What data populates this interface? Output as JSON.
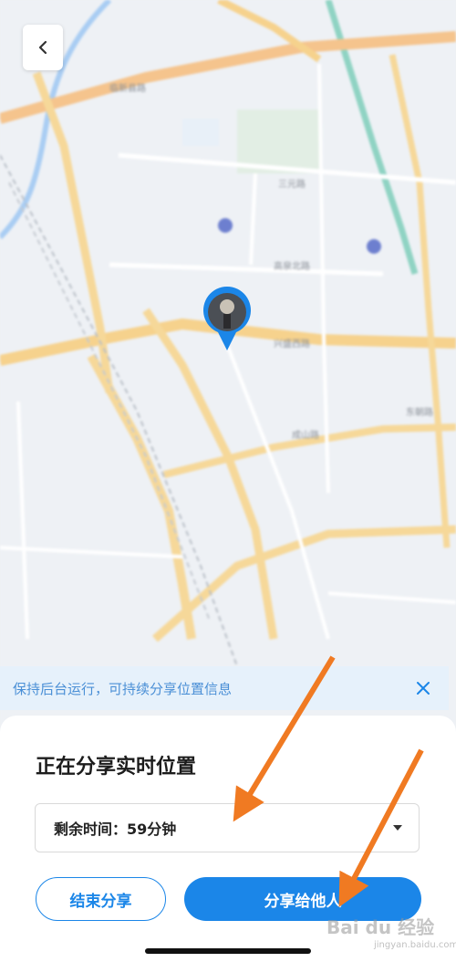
{
  "map": {
    "road_labels": [
      "临新县路",
      "兴盛西路",
      "三元路",
      "成山路",
      "高泉北路",
      "东朝路"
    ]
  },
  "nav": {
    "back_icon": "chevron-left-icon"
  },
  "banner": {
    "text": "保持后台运行，可持续分享位置信息",
    "close_icon": "close-icon"
  },
  "sheet": {
    "title": "正在分享实时位置",
    "remaining_time_label": "剩余时间：59分钟",
    "end_button": "结束分享",
    "share_button": "分享给他人"
  },
  "watermark": {
    "text": "Bai du 经验",
    "sub": "jingyan.baidu.com"
  },
  "colors": {
    "accent": "#1b86e8",
    "annotation_arrow": "#f07a22"
  }
}
